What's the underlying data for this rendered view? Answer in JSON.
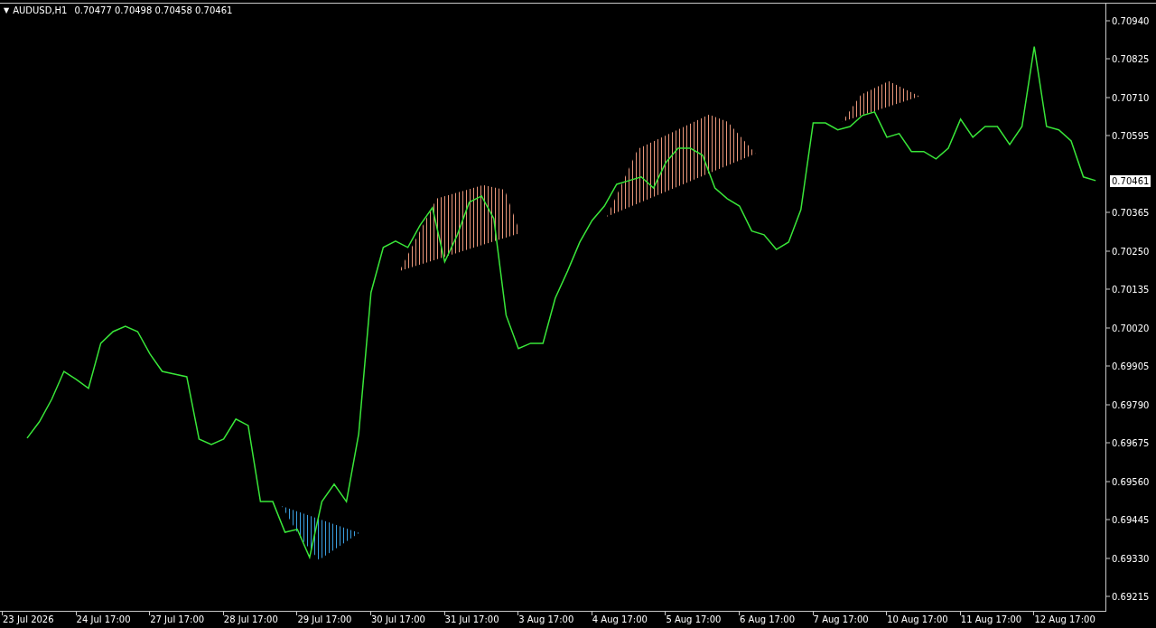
{
  "header": {
    "menu_glyph": "▼",
    "ohlc": [
      "0.70477",
      "0.70498",
      "0.70458",
      "0.70461"
    ]
  },
  "chart_data": {
    "type": "line",
    "ylim": [
      0.69173,
      0.70991
    ],
    "yticks": [
      {
        "value": 0.69215,
        "label": "0.69215"
      },
      {
        "value": 0.6933,
        "label": "0.69330"
      },
      {
        "value": 0.69445,
        "label": "0.69445"
      },
      {
        "value": 0.6956,
        "label": "0.69560"
      },
      {
        "value": 0.69675,
        "label": "0.69675"
      },
      {
        "value": 0.6979,
        "label": "0.69790"
      },
      {
        "value": 0.69905,
        "label": "0.69905"
      },
      {
        "value": 0.7002,
        "label": "0.70020"
      },
      {
        "value": 0.70135,
        "label": "0.70135"
      },
      {
        "value": 0.7025,
        "label": "0.70250"
      },
      {
        "value": 0.70365,
        "label": "0.70365"
      },
      {
        "value": 0.70595,
        "label": "0.70595"
      },
      {
        "value": 0.7071,
        "label": "0.70710"
      },
      {
        "value": 0.70825,
        "label": "0.70825"
      },
      {
        "value": 0.7094,
        "label": "0.70940"
      }
    ],
    "categories": [
      "23 Jul 2026",
      null,
      null,
      null,
      null,
      null,
      "24 Jul 17:00",
      null,
      null,
      null,
      null,
      null,
      "27 Jul 17:00",
      null,
      null,
      null,
      null,
      null,
      "28 Jul 17:00",
      null,
      null,
      null,
      null,
      null,
      "29 Jul 17:00",
      null,
      null,
      null,
      null,
      null,
      "30 Jul 17:00",
      null,
      null,
      null,
      null,
      null,
      "31 Jul 17:00",
      null,
      null,
      null,
      null,
      null,
      "3 Aug 17:00",
      null,
      null,
      null,
      null,
      null,
      "4 Aug 17:00",
      null,
      null,
      null,
      null,
      null,
      "5 Aug 17:00",
      null,
      null,
      null,
      null,
      null,
      "6 Aug 17:00",
      null,
      null,
      null,
      null,
      null,
      "7 Aug 17:00",
      null,
      null,
      null,
      null,
      null,
      "10 Aug 17:00",
      null,
      null,
      null,
      null,
      null,
      "11 Aug 17:00",
      null,
      null,
      null,
      null,
      null,
      "12 Aug 17:00",
      null,
      null,
      null
    ],
    "series": [
      {
        "name": "AUDUSD,H1",
        "color": "#39e639",
        "values": [
          0.6969,
          0.69739,
          0.69806,
          0.6989,
          0.69866,
          0.69839,
          0.69974,
          0.70009,
          0.70025,
          0.70009,
          0.69942,
          0.6989,
          0.69882,
          0.69874,
          0.69687,
          0.69671,
          0.69687,
          0.69747,
          0.69728,
          0.695,
          0.695,
          0.69408,
          0.69417,
          0.69333,
          0.695,
          0.69552,
          0.695,
          0.69703,
          0.70126,
          0.70261,
          0.7028,
          0.70261,
          0.70328,
          0.7038,
          0.70218,
          0.70296,
          0.70396,
          0.70415,
          0.70347,
          0.70058,
          0.69958,
          0.69974,
          0.69974,
          0.70109,
          0.7019,
          0.70277,
          0.70342,
          0.70385,
          0.7045,
          0.70461,
          0.70472,
          0.70439,
          0.70515,
          0.70558,
          0.70558,
          0.70537,
          0.70439,
          0.70407,
          0.70385,
          0.7031,
          0.70299,
          0.70255,
          0.70277,
          0.70374,
          0.70634,
          0.70634,
          0.70613,
          0.70623,
          0.70656,
          0.70667,
          0.70591,
          0.70602,
          0.70548,
          0.70548,
          0.70526,
          0.70558,
          0.70645,
          0.70591,
          0.70623,
          0.70623,
          0.70569,
          0.70623,
          0.70862,
          0.70623,
          0.70613,
          0.7058,
          0.70472,
          0.70461
        ]
      }
    ]
  },
  "zones": [
    {
      "color": "#e9967a"
    },
    {
      "color": "#e9967a"
    },
    {
      "color": "#e9967a"
    },
    {
      "color": "#3a9ee0"
    }
  ],
  "current_price": "0.70461"
}
